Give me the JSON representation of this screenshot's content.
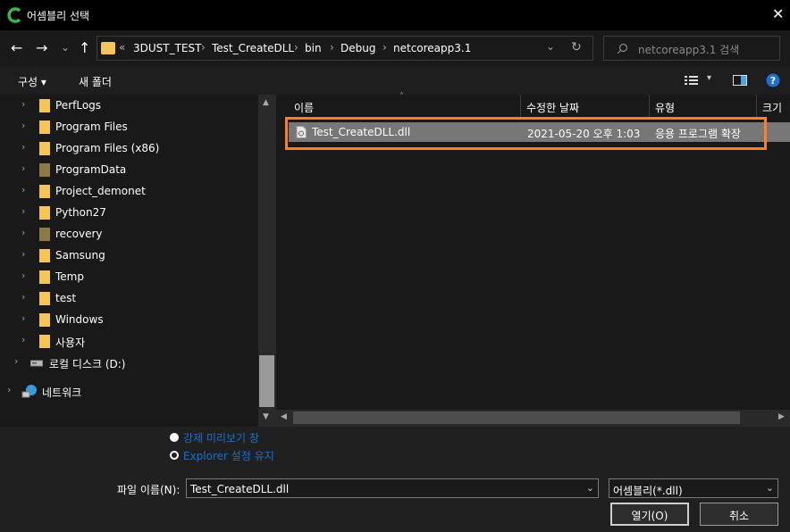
{
  "title": "어셈블리 선택",
  "close_icon": "✕",
  "nav": {
    "back": "←",
    "forward": "→",
    "recent": "⌄",
    "up": "↑"
  },
  "address": {
    "overflow": "«",
    "crumbs": [
      "3DUST_TEST",
      "Test_CreateDLL",
      "bin",
      "Debug",
      "netcoreapp3.1"
    ],
    "dropdown": "⌄",
    "refresh": "↻"
  },
  "search": {
    "placeholder": "netcoreapp3.1 검색"
  },
  "toolbar": {
    "organize": "구성 ▾",
    "new_folder": "새 폴더"
  },
  "tree": [
    {
      "label": "PerfLogs",
      "dim": false
    },
    {
      "label": "Program Files",
      "dim": false
    },
    {
      "label": "Program Files (x86)",
      "dim": false
    },
    {
      "label": "ProgramData",
      "dim": true
    },
    {
      "label": "Project_demonet",
      "dim": false
    },
    {
      "label": "Python27",
      "dim": false
    },
    {
      "label": "recovery",
      "dim": true
    },
    {
      "label": "Samsung",
      "dim": false
    },
    {
      "label": "Temp",
      "dim": false
    },
    {
      "label": "test",
      "dim": false
    },
    {
      "label": "Windows",
      "dim": false
    },
    {
      "label": "사용자",
      "dim": false
    }
  ],
  "drive": {
    "label": "로컬 디스크 (D:)"
  },
  "network": {
    "label": "네트워크"
  },
  "columns": {
    "name": "이름",
    "date": "수정한 날짜",
    "type": "유형",
    "size": "크기"
  },
  "files": [
    {
      "name": "Test_CreateDLL.dll",
      "date": "2021-05-20 오후 1:03",
      "type": "응용 프로그램 확장"
    }
  ],
  "options": {
    "force_preview": "강제 미리보기 창",
    "keep_explorer": "Explorer 설정 유지"
  },
  "filename": {
    "label": "파일 이름(N):",
    "value": "Test_CreateDLL.dll"
  },
  "filetype": {
    "value": "어셈블리(*.dll)"
  },
  "buttons": {
    "open": "열기(O)",
    "cancel": "취소"
  },
  "colors": {
    "accent": "#ff7f27",
    "folder": "#f3c55a",
    "link": "#1c6fd0"
  }
}
